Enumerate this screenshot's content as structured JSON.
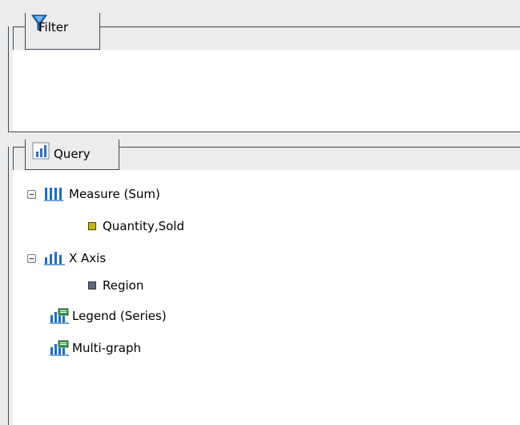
{
  "filter_panel": {
    "title": "Filter",
    "icon": "funnel-icon"
  },
  "query_panel": {
    "title": "Query",
    "icon": "bar-chart-icon",
    "tree": {
      "measure": {
        "label": "Measure (Sum)",
        "icon": "measure-bars-icon",
        "expanded": true
      },
      "quantity_sold": {
        "label": "Quantity,Sold",
        "icon": "numeric-field-icon",
        "color": "#c9b400"
      },
      "x_axis": {
        "label": "X Axis",
        "icon": "axis-bars-icon",
        "expanded": true
      },
      "region": {
        "label": "Region",
        "icon": "dimension-field-icon",
        "color": "#5f6b7a"
      },
      "legend": {
        "label": "Legend (Series)",
        "icon": "legend-chart-icon"
      },
      "multigraph": {
        "label": "Multi-graph",
        "icon": "multigraph-chart-icon"
      }
    }
  }
}
